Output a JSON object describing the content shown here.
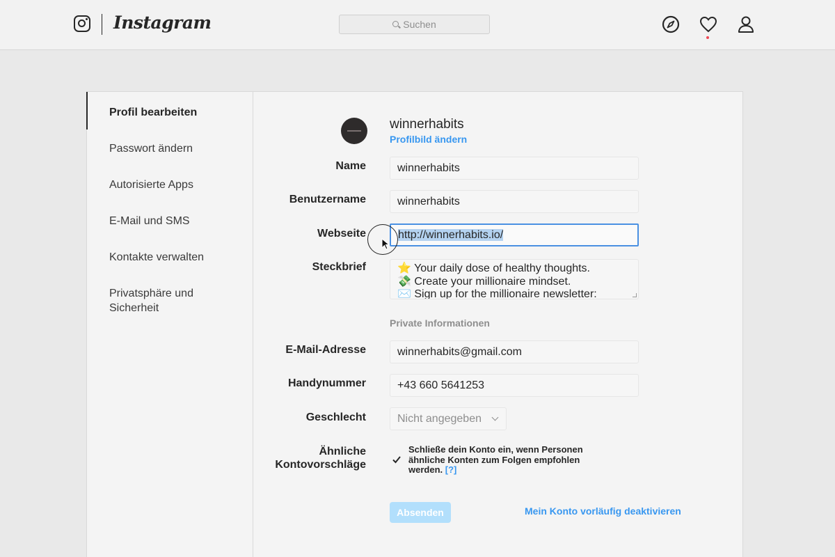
{
  "topbar": {
    "brand": "Instagram",
    "search_placeholder": "Suchen",
    "icons": [
      "camera-logo-icon",
      "compass-icon",
      "heart-icon",
      "user-icon"
    ],
    "notification_color": "#ed4956"
  },
  "sidebar": {
    "items": [
      {
        "label": "Profil bearbeiten",
        "active": true
      },
      {
        "label": "Passwort ändern"
      },
      {
        "label": "Autorisierte Apps"
      },
      {
        "label": "E-Mail und SMS"
      },
      {
        "label": "Kontakte verwalten"
      },
      {
        "label": "Privatsphäre und Sicherheit"
      }
    ]
  },
  "profile": {
    "username": "winnerhabits",
    "change_photo": "Profilbild ändern"
  },
  "form": {
    "name_label": "Name",
    "name_value": "winnerhabits",
    "username_label": "Benutzername",
    "username_value": "winnerhabits",
    "website_label": "Webseite",
    "website_value": "http://winnerhabits.io/",
    "bio_label": "Steckbrief",
    "bio_lines": [
      "⭐ Your daily dose of healthy thoughts.",
      "💸 Create your millionaire mindset.",
      "✉️ Sign up for the millionaire newsletter:"
    ],
    "private_info_heading": "Private Informationen",
    "email_label": "E-Mail-Adresse",
    "email_value": "winnerhabits@gmail.com",
    "phone_label": "Handynummer",
    "phone_value": "+43 660 5641253",
    "gender_label": "Geschlecht",
    "gender_value": "Nicht angegeben",
    "suggestions_label_1": "Ähnliche",
    "suggestions_label_2": "Kontovorschläge",
    "suggestions_text": "Schließe dein Konto ein, wenn Personen ähnliche Konten zum Folgen empfohlen werden.",
    "suggestions_help": "[?]",
    "suggestions_checked": true,
    "submit_label": "Absenden",
    "deactivate_label": "Mein Konto vorläufig deaktivieren"
  },
  "colors": {
    "accent": "#3897f0",
    "focus": "#4a90e2",
    "submit_disabled": "#b2dffc"
  }
}
